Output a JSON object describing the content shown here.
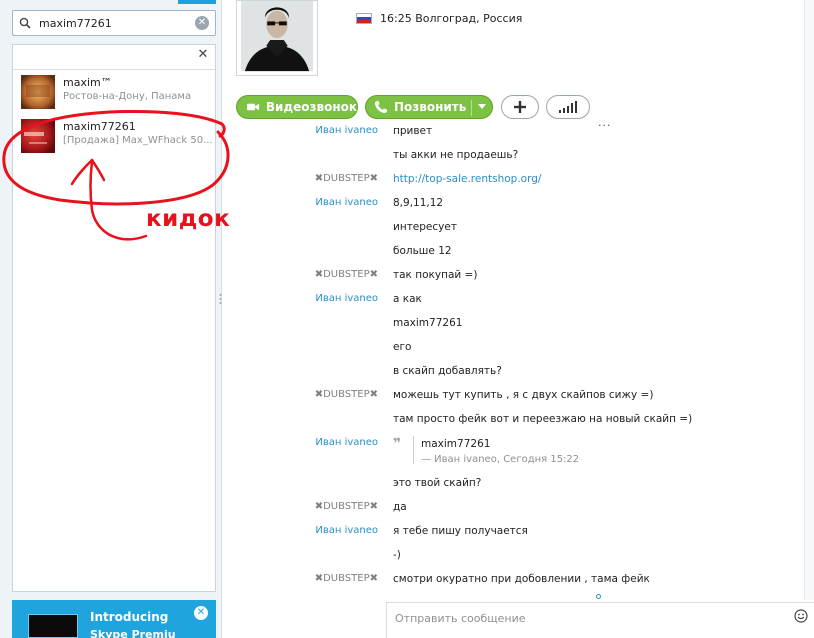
{
  "search": {
    "value": "maxim77261"
  },
  "results": [
    {
      "name": "maxim™",
      "subtitle": "Ростов-на-Дону, Панама"
    },
    {
      "name": "maxim77261",
      "subtitle": "[Продажа] Max_WFhack 50..."
    }
  ],
  "promo": {
    "title": "Introducing",
    "subtitle": "Skype Premiu"
  },
  "header": {
    "location": "16:25 Волгоград, Россия"
  },
  "actions": {
    "video_call": "Видеозвонок",
    "call": "Позвонить"
  },
  "messages": [
    {
      "sender": "Иван ivaneo",
      "text": "привет"
    },
    {
      "sender": "",
      "text": "ты акки не продаешь?"
    },
    {
      "sender": "✖DUBSTEP✖",
      "text": "http://top-sale.rentshop.org/"
    },
    {
      "sender": "Иван ivaneo",
      "text": "8,9,11,12"
    },
    {
      "sender": "",
      "text": "интересует"
    },
    {
      "sender": "",
      "text": "больше 12"
    },
    {
      "sender": "✖DUBSTEP✖",
      "text": "так покупай =)"
    },
    {
      "sender": "Иван ivaneo",
      "text": "а как"
    },
    {
      "sender": "",
      "text": "maxim77261"
    },
    {
      "sender": "",
      "text": "его"
    },
    {
      "sender": "",
      "text": "в скайп добавлять?"
    },
    {
      "sender": "✖DUBSTEP✖",
      "text": "можешь тут купить , я с двух скайпов сижу =)"
    },
    {
      "sender": "",
      "text": "там просто фейк вот и переезжаю на новый скайп =)"
    },
    {
      "sender": "Иван ivaneo",
      "text": ""
    },
    {
      "sender": "",
      "text": "это твой скайп?"
    },
    {
      "sender": "✖DUBSTEP✖",
      "text": "да"
    },
    {
      "sender": "Иван ivaneo",
      "text": "я тебе пишу получается"
    },
    {
      "sender": "",
      "text": "-)"
    },
    {
      "sender": "✖DUBSTEP✖",
      "text": "смотри окуратно при добовлении , тама фейк"
    }
  ],
  "quote": {
    "text": "maxim77261",
    "meta": "— Иван ivaneo, Сегодня 15:22"
  },
  "compose": {
    "placeholder": "Отправить сообщение"
  },
  "annotation": {
    "label": "кидок",
    "color": "#e8111c"
  },
  "colors": {
    "accent": "#1fa4de",
    "call_green": "#7dc242",
    "link": "#2a8fc4"
  }
}
